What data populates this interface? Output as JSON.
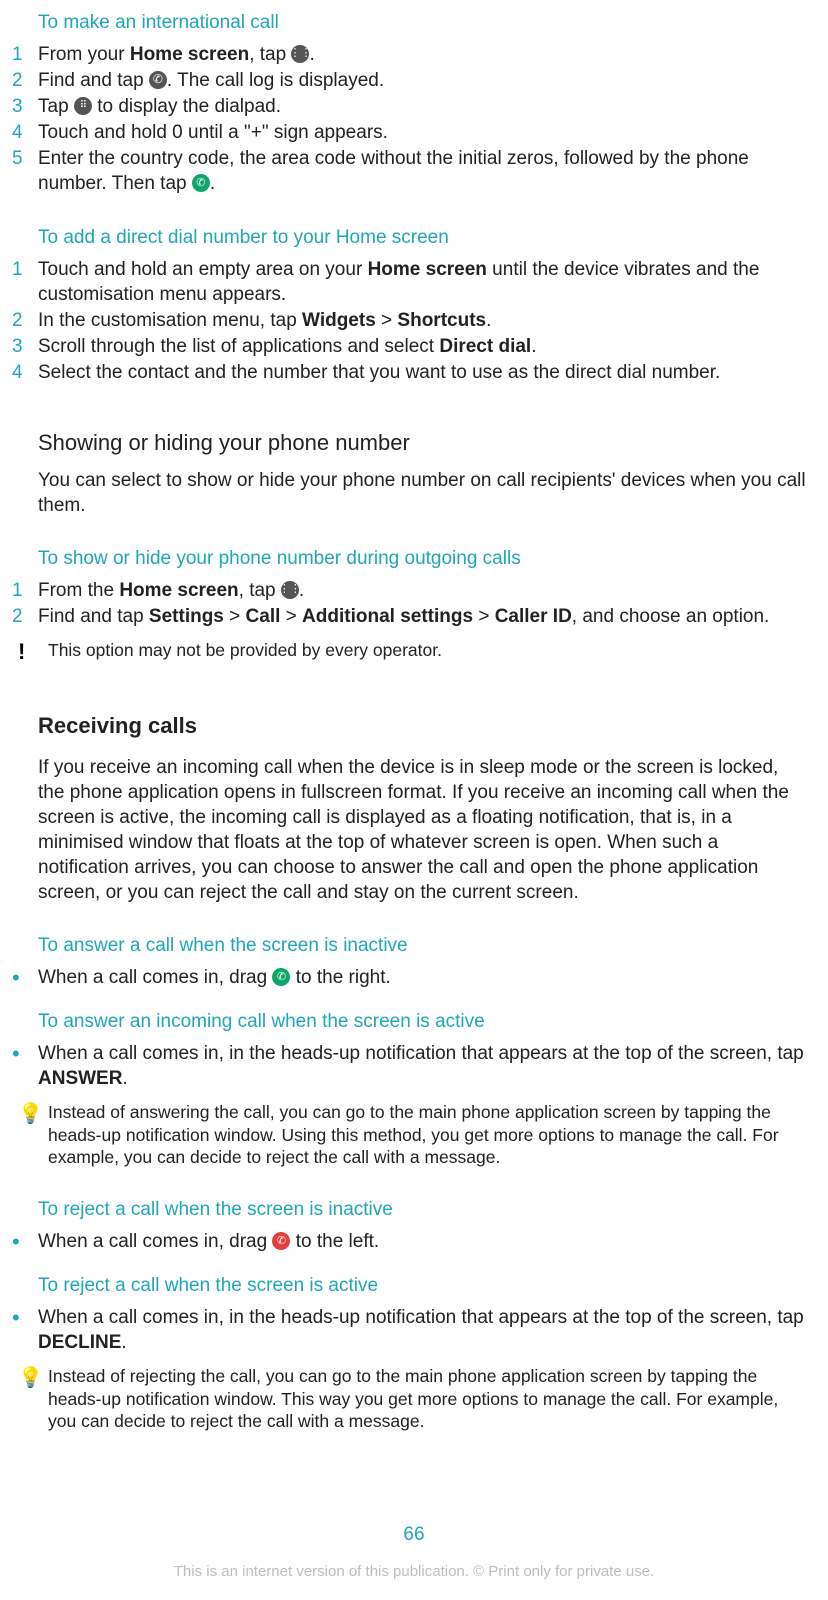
{
  "headings": {
    "intl_call": "To make an international call",
    "direct_dial": "To add a direct dial number to your Home screen",
    "show_hide_number": "Showing or hiding your phone number",
    "show_hide_outgoing": "To show or hide your phone number during outgoing calls",
    "receiving_calls": "Receiving calls",
    "answer_inactive": "To answer a call when the screen is inactive",
    "answer_active": "To answer an incoming call when the screen is active",
    "reject_inactive": "To reject a call when the screen is inactive",
    "reject_active": "To reject a call when the screen is active"
  },
  "intl_steps": {
    "s1_a": "From your ",
    "s1_b": "Home screen",
    "s1_c": ", tap ",
    "s1_d": ".",
    "s2_a": "Find and tap ",
    "s2_b": ". The call log is displayed.",
    "s3_a": "Tap ",
    "s3_b": " to display the dialpad.",
    "s4": "Touch and hold 0 until a \"+\" sign appears.",
    "s5_a": "Enter the country code, the area code without the initial zeros, followed by the phone number. Then tap ",
    "s5_b": "."
  },
  "direct_dial_steps": {
    "s1_a": "Touch and hold an empty area on your ",
    "s1_b": "Home screen",
    "s1_c": " until the device vibrates and the customisation menu appears.",
    "s2_a": "In the customisation menu, tap ",
    "s2_b": "Widgets",
    "s2_c": " > ",
    "s2_d": "Shortcuts",
    "s2_e": ".",
    "s3_a": "Scroll through the list of applications and select ",
    "s3_b": "Direct dial",
    "s3_c": ".",
    "s4": "Select the contact and the number that you want to use as the direct dial number."
  },
  "show_hide_para": "You can select to show or hide your phone number on call recipients' devices when you call them.",
  "show_hide_steps": {
    "s1_a": "From the ",
    "s1_b": "Home screen",
    "s1_c": ", tap ",
    "s1_d": ".",
    "s2_a": "Find and tap ",
    "s2_b": "Settings",
    "s2_c": " > ",
    "s2_d": "Call",
    "s2_e": " > ",
    "s2_f": "Additional settings",
    "s2_g": " > ",
    "s2_h": "Caller ID",
    "s2_i": ", and choose an option."
  },
  "operator_note": "This option may not be provided by every operator.",
  "receiving_para": "If you receive an incoming call when the device is in sleep mode or the screen is locked, the phone application opens in fullscreen format. If you receive an incoming call when the screen is active, the incoming call is displayed as a floating notification, that is, in a minimised window that floats at the top of whatever screen is open. When such a notification arrives, you can choose to answer the call and open the phone application screen, or you can reject the call and stay on the current screen.",
  "answer_inactive_bullet": {
    "a": "When a call comes in, drag ",
    "b": " to the right."
  },
  "answer_active_bullet": {
    "a": "When a call comes in, in the heads-up notification that appears at the top of the screen, tap ",
    "b": "ANSWER",
    "c": "."
  },
  "answer_tip": "Instead of answering the call, you can go to the main phone application screen by tapping the heads-up notification window. Using this method, you get more options to manage the call. For example, you can decide to reject the call with a message.",
  "reject_inactive_bullet": {
    "a": "When a call comes in, drag ",
    "b": " to the left."
  },
  "reject_active_bullet": {
    "a": "When a call comes in, in the heads-up notification that appears at the top of the screen, tap ",
    "b": "DECLINE",
    "c": "."
  },
  "reject_tip": "Instead of rejecting the call, you can go to the main phone application screen by tapping the heads-up notification window. This way you get more options to manage the call. For example, you can decide to reject the call with a message.",
  "page_number": "66",
  "footer": "This is an internet version of this publication. © Print only for private use.",
  "nums": {
    "n1": "1",
    "n2": "2",
    "n3": "3",
    "n4": "4",
    "n5": "5"
  },
  "bullet_char": "•",
  "icons": {
    "apps_grid": "apps-grid-icon",
    "phone": "phone-icon",
    "dialpad": "dialpad-icon",
    "call_answer": "call-answer-icon",
    "call_reject": "call-reject-icon",
    "warning": "warning-icon",
    "bulb": "lightbulb-icon"
  }
}
